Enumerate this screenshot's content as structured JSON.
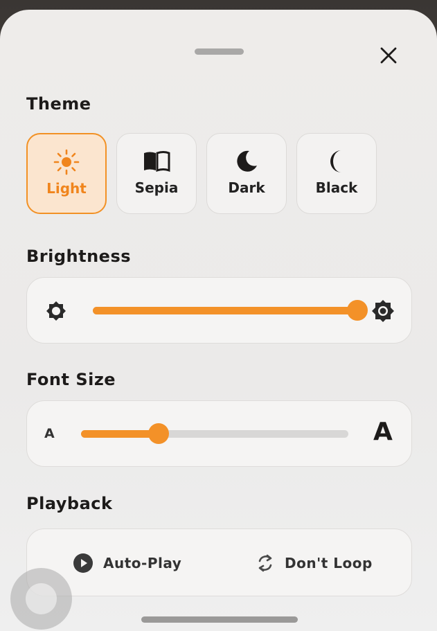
{
  "close_label": "close",
  "sections": {
    "theme": "Theme",
    "brightness": "Brightness",
    "font_size": "Font Size",
    "playback": "Playback"
  },
  "themes": [
    {
      "label": "Light",
      "icon": "sun-icon",
      "selected": true
    },
    {
      "label": "Sepia",
      "icon": "book-open-icon",
      "selected": false
    },
    {
      "label": "Dark",
      "icon": "moon-icon",
      "selected": false
    },
    {
      "label": "Black",
      "icon": "crescent-moon-icon",
      "selected": false
    }
  ],
  "brightness": {
    "value_percent": 100,
    "min_icon": "brightness-low-icon",
    "max_icon": "brightness-high-icon"
  },
  "font_size": {
    "value_percent": 29,
    "small_label": "A",
    "large_label": "A"
  },
  "playback": {
    "auto_play": "Auto-Play",
    "loop": "Don't Loop"
  },
  "colors": {
    "accent": "#f39128",
    "accent_text": "#f0851d",
    "selected_bg": "#fbe5cf"
  }
}
